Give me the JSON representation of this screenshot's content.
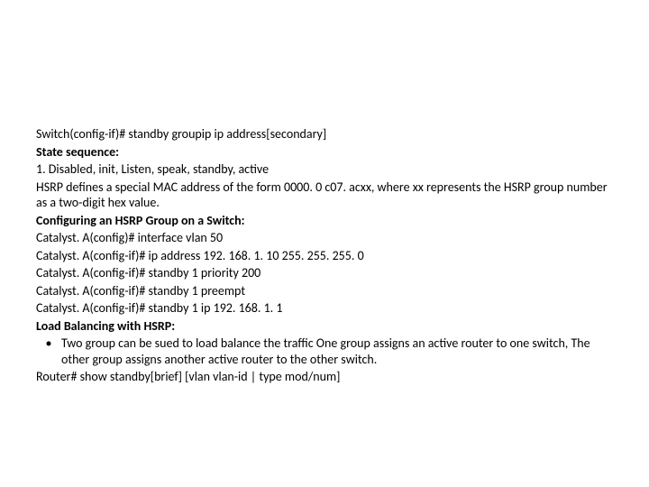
{
  "lines": {
    "l1": "Switch(config-if)# standby groupip ip address[secondary]",
    "l2": "State sequence:",
    "l3": "1. Disabled, init, Listen, speak, standby, active",
    "l4": "HSRP defines a special MAC address of the form 0000. 0 c07. acxx, where xx represents the HSRP group number as a two-digit hex value.",
    "l5": "Configuring an HSRP Group on a Switch:",
    "l6": "Catalyst. A(config)# interface vlan 50",
    "l7": "Catalyst. A(config-if)# ip address 192. 168. 1. 10 255. 255. 255. 0",
    "l8": "Catalyst. A(config-if)# standby 1 priority 200",
    "l9": "Catalyst. A(config-if)# standby 1 preempt",
    "l10": "Catalyst. A(config-if)# standby 1 ip 192. 168. 1. 1",
    "l11": "Load Balancing with HSRP:",
    "bullet_mark": "•",
    "l12": "Two group can be sued to load balance the traffic  One group assigns an active router to one switch, The other group assigns another active router to the other switch.",
    "l13": "Router# show standby[brief] [vlan vlan-id | type mod/num]"
  }
}
